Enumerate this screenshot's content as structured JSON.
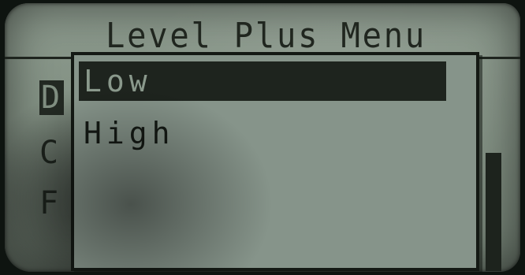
{
  "screen": {
    "title": "Level Plus Menu",
    "background_items": [
      {
        "label": "D",
        "selected": true
      },
      {
        "label": "C",
        "selected": false
      },
      {
        "label": "F",
        "selected": false
      }
    ]
  },
  "popup": {
    "options": [
      {
        "label": "Low",
        "selected": true
      },
      {
        "label": "High",
        "selected": false
      }
    ]
  },
  "colors": {
    "lcd_background": "#86948a",
    "pixel": "#1a201b"
  }
}
